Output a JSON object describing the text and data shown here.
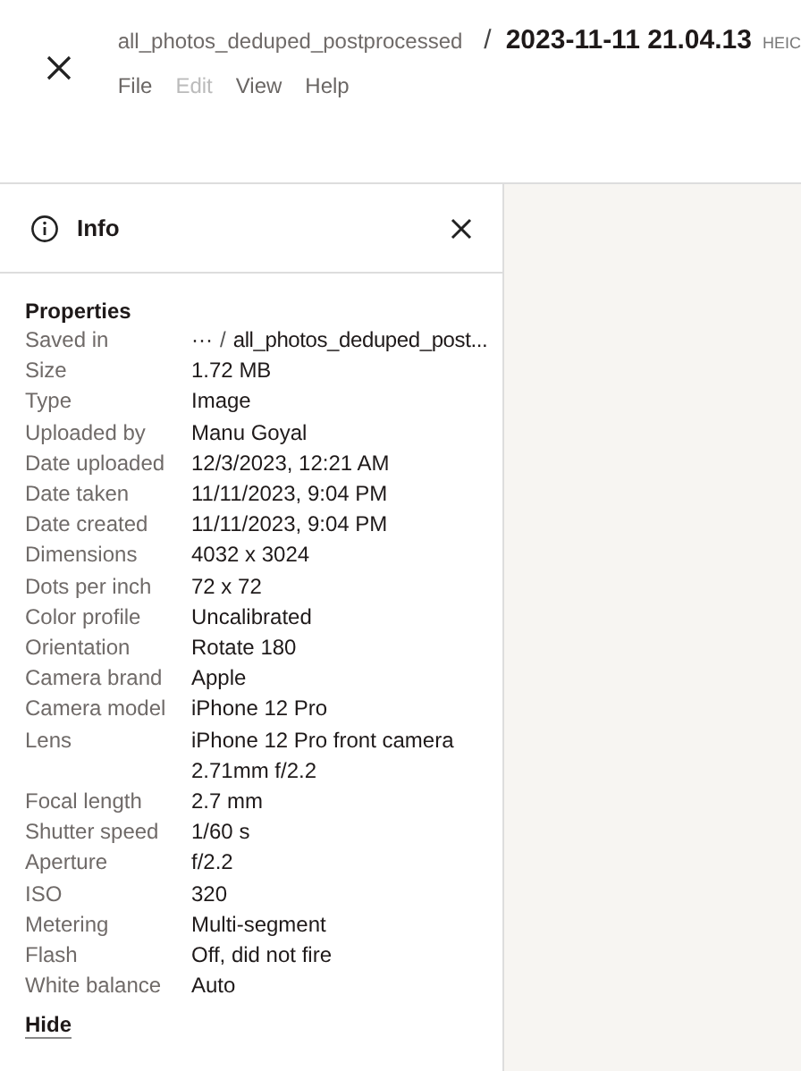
{
  "header": {
    "folder": "all_photos_deduped_postprocessed",
    "separator": "/",
    "title": "2023-11-11 21.04.13",
    "extension": "HEIC"
  },
  "menu": [
    {
      "label": "File",
      "disabled": false
    },
    {
      "label": "Edit",
      "disabled": true
    },
    {
      "label": "View",
      "disabled": false
    },
    {
      "label": "Help",
      "disabled": false
    }
  ],
  "panel": {
    "title": "Info",
    "section": "Properties",
    "saved_in": {
      "label": "Saved in",
      "more": "···",
      "separator": "/",
      "path": "all_photos_deduped_post..."
    },
    "properties": [
      {
        "label": "Size",
        "value": "1.72 MB"
      },
      {
        "label": "Type",
        "value": "Image"
      },
      {
        "label": "Uploaded by",
        "value": "Manu Goyal"
      },
      {
        "label": "Date uploaded",
        "value": "12/3/2023, 12:21 AM"
      },
      {
        "label": "Date taken",
        "value": "11/11/2023, 9:04 PM"
      },
      {
        "label": "Date created",
        "value": "11/11/2023, 9:04 PM"
      },
      {
        "label": "Dimensions",
        "value": "4032 x 3024"
      },
      {
        "label": "Dots per inch",
        "value": "72 x 72"
      },
      {
        "label": "Color profile",
        "value": "Uncalibrated"
      },
      {
        "label": "Orientation",
        "value": "Rotate 180"
      },
      {
        "label": "Camera brand",
        "value": "Apple"
      },
      {
        "label": "Camera model",
        "value": "iPhone 12 Pro"
      },
      {
        "label": "Lens",
        "value": "iPhone 12 Pro front camera 2.71mm f/2.2"
      },
      {
        "label": "Focal length",
        "value": "2.7 mm"
      },
      {
        "label": "Shutter speed",
        "value": "1/60 s"
      },
      {
        "label": "Aperture",
        "value": "f/2.2"
      },
      {
        "label": "ISO",
        "value": "320"
      },
      {
        "label": "Metering",
        "value": "Multi-segment"
      },
      {
        "label": "Flash",
        "value": "Off, did not fire"
      },
      {
        "label": "White balance",
        "value": "Auto"
      }
    ],
    "hide": "Hide"
  }
}
